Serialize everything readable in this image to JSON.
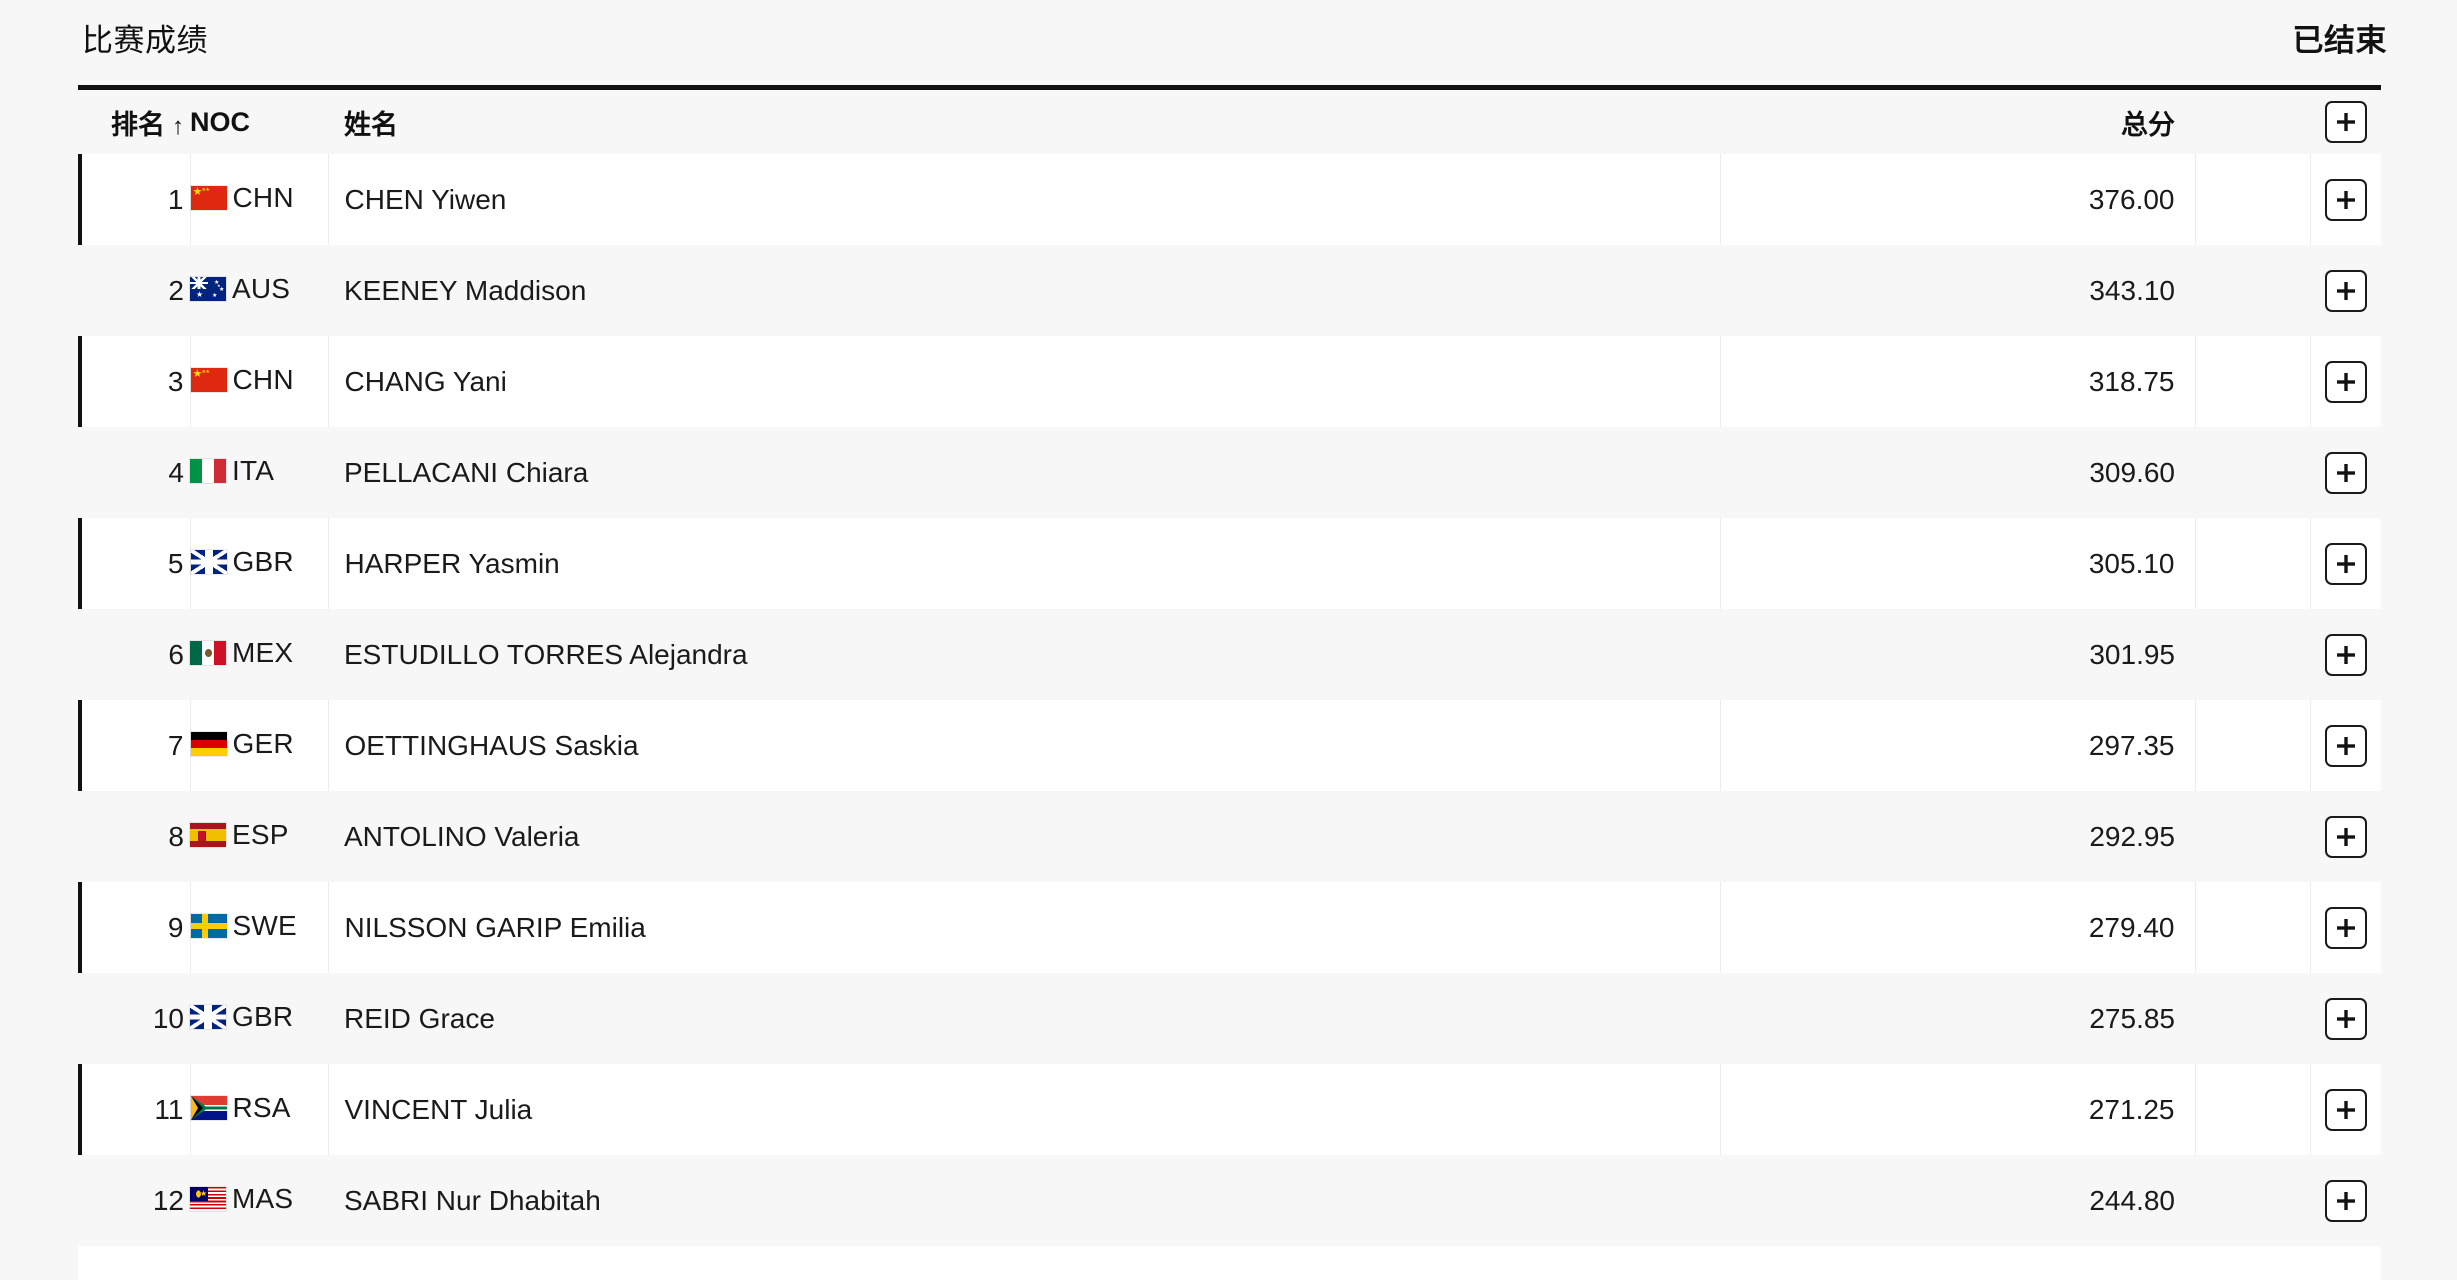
{
  "panel": {
    "title": "比赛成绩",
    "status": "已结束"
  },
  "table": {
    "columns": {
      "rank": "排名",
      "sort_arrow": "↑",
      "noc": "NOC",
      "name": "姓名",
      "total": "总分",
      "expand_icon": "plus-icon"
    },
    "add_button_label": "+",
    "rows": [
      {
        "rank": "1",
        "noc": "CHN",
        "flag": "chn",
        "name": "CHEN Yiwen",
        "total": "376.00"
      },
      {
        "rank": "2",
        "noc": "AUS",
        "flag": "aus",
        "name": "KEENEY Maddison",
        "total": "343.10"
      },
      {
        "rank": "3",
        "noc": "CHN",
        "flag": "chn",
        "name": "CHANG Yani",
        "total": "318.75"
      },
      {
        "rank": "4",
        "noc": "ITA",
        "flag": "ita",
        "name": "PELLACANI Chiara",
        "total": "309.60"
      },
      {
        "rank": "5",
        "noc": "GBR",
        "flag": "gbr",
        "name": "HARPER Yasmin",
        "total": "305.10"
      },
      {
        "rank": "6",
        "noc": "MEX",
        "flag": "mex",
        "name": "ESTUDILLO TORRES Alejandra",
        "total": "301.95"
      },
      {
        "rank": "7",
        "noc": "GER",
        "flag": "ger",
        "name": "OETTINGHAUS Saskia",
        "total": "297.35"
      },
      {
        "rank": "8",
        "noc": "ESP",
        "flag": "esp",
        "name": "ANTOLINO Valeria",
        "total": "292.95"
      },
      {
        "rank": "9",
        "noc": "SWE",
        "flag": "swe",
        "name": "NILSSON GARIP Emilia",
        "total": "279.40"
      },
      {
        "rank": "10",
        "noc": "GBR",
        "flag": "gbr",
        "name": "REID Grace",
        "total": "275.85"
      },
      {
        "rank": "11",
        "noc": "RSA",
        "flag": "rsa",
        "name": "VINCENT Julia",
        "total": "271.25"
      },
      {
        "rank": "12",
        "noc": "MAS",
        "flag": "mas",
        "name": "SABRI Nur Dhabitah",
        "total": "244.80"
      }
    ]
  },
  "colors": {
    "page_background": "#f7f7f7",
    "row_white": "#ffffff",
    "row_alt": "#f7f7f7",
    "accent_bar": "#111111",
    "text": "#141414"
  }
}
